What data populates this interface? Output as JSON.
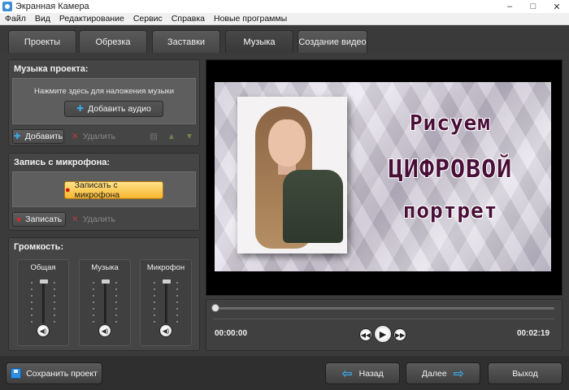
{
  "window": {
    "title": "Экранная Камера",
    "minimize": "–",
    "maximize": "□",
    "close": "✕"
  },
  "menu": [
    "Файл",
    "Вид",
    "Редактирование",
    "Сервис",
    "Справка",
    "Новые программы"
  ],
  "tabs": [
    {
      "label": "Проекты"
    },
    {
      "label": "Обрезка"
    },
    {
      "label": "Заставки"
    },
    {
      "label": "Музыка",
      "active": true
    },
    {
      "label": "Создание видео"
    }
  ],
  "music_panel": {
    "title": "Музыка проекта:",
    "hint": "Нажмите здесь для наложения музыки",
    "add_audio": "Добавить аудио",
    "add": "Добавить",
    "remove": "Удалить"
  },
  "mic_panel": {
    "title": "Запись с микрофона:",
    "record_big": "Записать с микрофона",
    "record": "Записать",
    "remove": "Удалить"
  },
  "volume_panel": {
    "title": "Громкость:",
    "channels": [
      {
        "label": "Общая",
        "level": 1.0
      },
      {
        "label": "Музыка",
        "level": 1.0
      },
      {
        "label": "Микрофон",
        "level": 1.0
      }
    ]
  },
  "preview": {
    "line1": "Рисуем",
    "line2": "ЦИФРОВОЙ",
    "line3": "портрет"
  },
  "player": {
    "current_time": "00:00:00",
    "total_time": "00:02:19",
    "position": 0.0
  },
  "footer": {
    "save": "Сохранить проект",
    "back": "Назад",
    "next": "Далее",
    "exit": "Выход"
  },
  "colors": {
    "accent": "#39a8e8",
    "record_button": "#f7b52e",
    "headline": "#4a0f38"
  }
}
